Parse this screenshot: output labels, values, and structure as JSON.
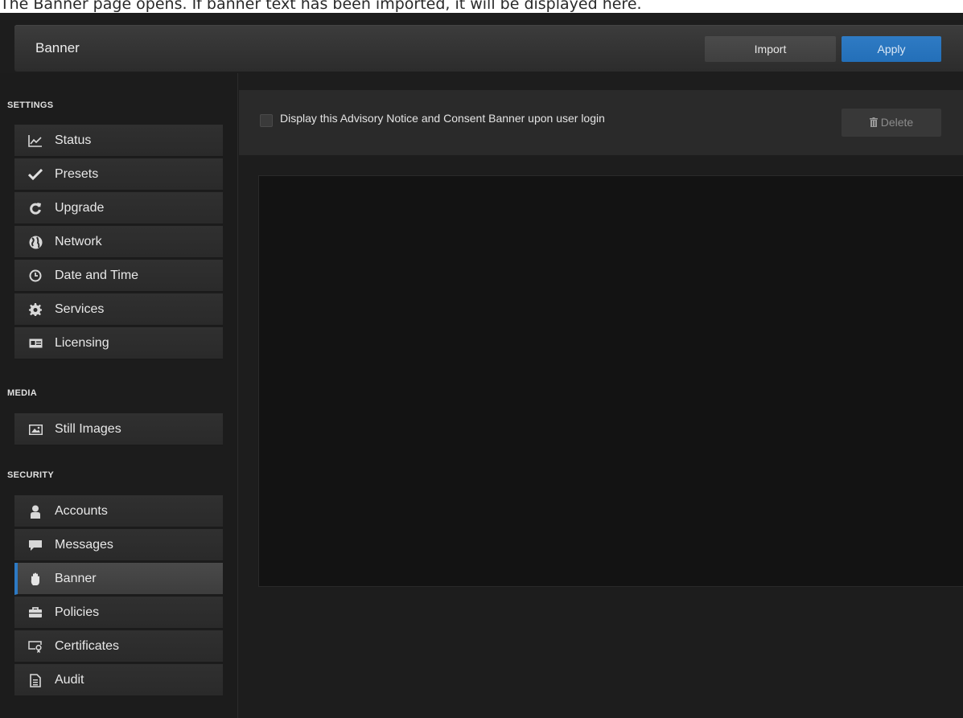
{
  "caption": "The Banner page opens. If banner text has been imported, it will be displayed here.",
  "header": {
    "title": "Banner",
    "import_label": "Import",
    "apply_label": "Apply"
  },
  "sidebar": {
    "settings_label": "SETTINGS",
    "media_label": "MEDIA",
    "security_label": "SECURITY",
    "settings_items": [
      {
        "label": "Status",
        "icon": "chart-line-icon"
      },
      {
        "label": "Presets",
        "icon": "checkmark-icon"
      },
      {
        "label": "Upgrade",
        "icon": "refresh-icon"
      },
      {
        "label": "Network",
        "icon": "globe-icon"
      },
      {
        "label": "Date and Time",
        "icon": "clock-icon"
      },
      {
        "label": "Services",
        "icon": "gear-icon"
      },
      {
        "label": "Licensing",
        "icon": "license-card-icon"
      }
    ],
    "media_items": [
      {
        "label": "Still Images",
        "icon": "image-icon"
      }
    ],
    "security_items": [
      {
        "label": "Accounts",
        "icon": "user-icon"
      },
      {
        "label": "Messages",
        "icon": "speech-bubble-icon"
      },
      {
        "label": "Banner",
        "icon": "hand-icon",
        "active": true
      },
      {
        "label": "Policies",
        "icon": "briefcase-icon"
      },
      {
        "label": "Certificates",
        "icon": "certificate-icon"
      },
      {
        "label": "Audit",
        "icon": "document-icon"
      }
    ]
  },
  "main": {
    "banner_checkbox_label": "Display this Advisory Notice and Consent Banner upon user login",
    "banner_checkbox_checked": false,
    "delete_label": "Delete",
    "banner_text": ""
  },
  "colors": {
    "accent": "#2d7ac4",
    "background": "#1d1d1d"
  }
}
